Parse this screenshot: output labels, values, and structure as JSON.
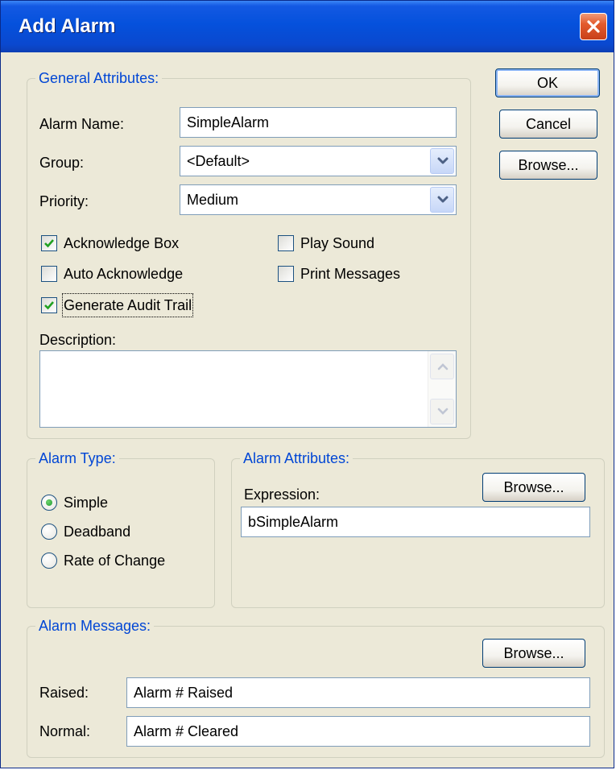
{
  "window": {
    "title": "Add Alarm"
  },
  "buttons": {
    "ok": "OK",
    "cancel": "Cancel",
    "browse": "Browse..."
  },
  "general": {
    "legend": "General Attributes:",
    "alarm_name_label": "Alarm Name:",
    "alarm_name_value": "SimpleAlarm",
    "group_label": "Group:",
    "group_value": "<Default>",
    "priority_label": "Priority:",
    "priority_value": "Medium",
    "checkboxes": {
      "acknowledge_box": {
        "label": "Acknowledge Box",
        "checked": true
      },
      "play_sound": {
        "label": "Play Sound",
        "checked": false
      },
      "auto_acknowledge": {
        "label": "Auto Acknowledge",
        "checked": false
      },
      "print_messages": {
        "label": "Print  Messages",
        "checked": false
      },
      "generate_audit_trail": {
        "label": "Generate Audit Trail",
        "checked": true
      }
    },
    "description_label": "Description:",
    "description_value": ""
  },
  "alarm_type": {
    "legend": "Alarm Type:",
    "options": [
      "Simple",
      "Deadband",
      "Rate of Change"
    ],
    "selected": "Simple"
  },
  "alarm_attributes": {
    "legend": "Alarm Attributes:",
    "expression_label": "Expression:",
    "expression_value": "bSimpleAlarm",
    "browse_label": "Browse..."
  },
  "alarm_messages": {
    "legend": "Alarm Messages:",
    "browse_label": "Browse...",
    "raised_label": "Raised:",
    "raised_value": "Alarm # Raised",
    "normal_label": "Normal:",
    "normal_value": "Alarm # Cleared"
  },
  "colors": {
    "titlebar": "#0551dc",
    "legend_text": "#0046d5",
    "dialog_bg": "#ece9d8",
    "close_button": "#e35b2d"
  }
}
